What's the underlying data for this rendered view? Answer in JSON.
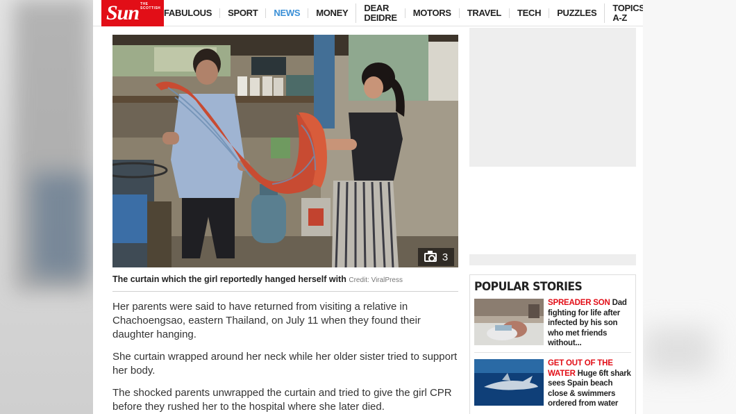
{
  "site": {
    "logo_small": "THE SCOTTISH",
    "logo_main": "Sun",
    "brand_color": "#e20e17"
  },
  "nav": {
    "items": [
      {
        "label": "FABULOUS"
      },
      {
        "label": "SPORT"
      },
      {
        "label": "NEWS",
        "active": true
      },
      {
        "label": "MONEY"
      },
      {
        "label": "DEAR DEIDRE"
      },
      {
        "label": "MOTORS"
      },
      {
        "label": "TRAVEL"
      },
      {
        "label": "TECH"
      },
      {
        "label": "PUZZLES"
      },
      {
        "label": "TOPICS A-Z"
      }
    ],
    "active_color": "#3a8fd6"
  },
  "article": {
    "photo_count": "3",
    "photo_count_icon": "camera-icon",
    "caption": "The curtain which the girl reportedly hanged herself with",
    "credit": "Credit: ViralPress",
    "paragraphs": [
      "Her parents were said to have returned from visiting a relative in Chachoengsao, eastern Thailand, on July 11 when they found their daughter hanging.",
      "She curtain wrapped around her neck while her older sister tried to support her body.",
      "The shocked parents unwrapped the curtain and tried to give the girl CPR before they rushed her to the hospital where she later died."
    ]
  },
  "sidebar": {
    "popular_title": "POPULAR STORIES",
    "stories": [
      {
        "kicker": "SPREADER SON",
        "headline": "Dad fighting for life after infected by his son who met friends without..."
      },
      {
        "kicker": "GET OUT OF THE WATER",
        "headline": "Huge 6ft shark sees Spain beach close & swimmers ordered from water"
      }
    ]
  }
}
